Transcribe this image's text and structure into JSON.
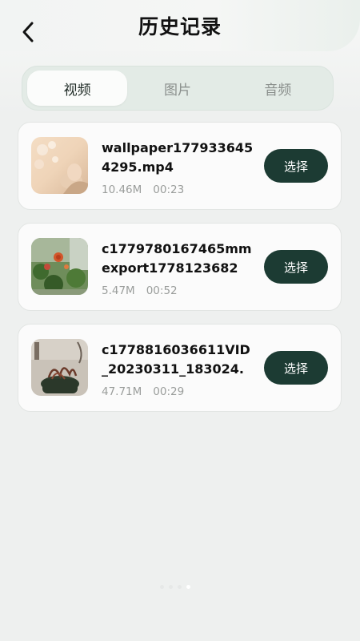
{
  "header": {
    "title": "历史记录",
    "back_icon": "chevron-left-icon"
  },
  "tabs": [
    {
      "label": "视频",
      "active": true
    },
    {
      "label": "图片",
      "active": false
    },
    {
      "label": "音频",
      "active": false
    }
  ],
  "items": [
    {
      "name": "wallpaper1779336454295.mp4",
      "size": "10.46M",
      "duration": "00:23",
      "select_label": "选择",
      "thumb": "portrait-flowers-thumbnail"
    },
    {
      "name": "c1779780167465mmexport1778123682",
      "size": "5.47M",
      "duration": "00:52",
      "select_label": "选择",
      "thumb": "rose-garden-thumbnail"
    },
    {
      "name": "c1778816036611VID_20230311_183024.",
      "size": "47.71M",
      "duration": "00:29",
      "select_label": "选择",
      "thumb": "potted-plant-thumbnail"
    }
  ],
  "page_indicator": {
    "count": 4,
    "active_index": 3
  }
}
